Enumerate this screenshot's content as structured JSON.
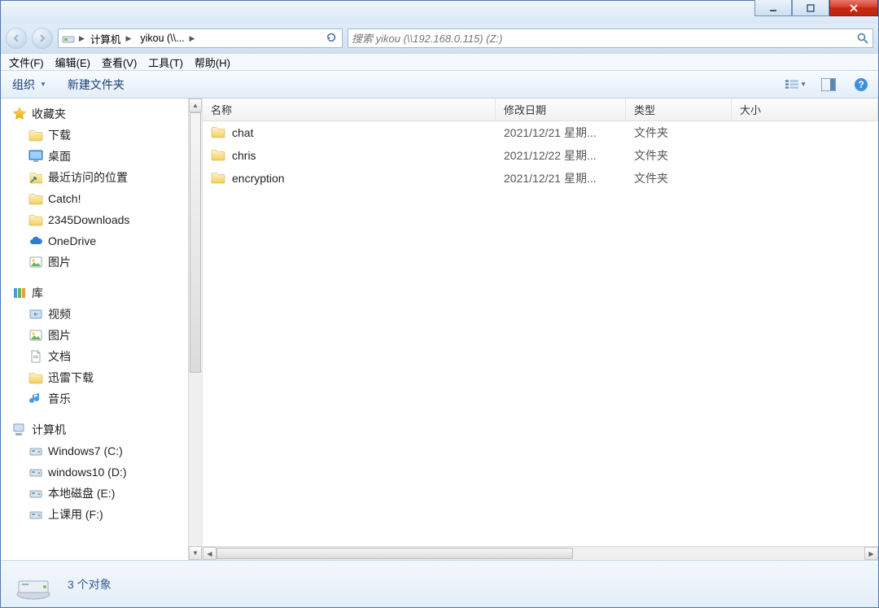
{
  "window": {
    "title": "yikou (\\\\192.168.0.115) (Z:)"
  },
  "breadcrumb": {
    "seg1": "计算机",
    "seg2": "yikou (\\\\...",
    "refresh_tip": "刷新"
  },
  "search": {
    "placeholder": "搜索 yikou (\\\\192.168.0.115) (Z:)"
  },
  "menubar": {
    "file": "文件(F)",
    "edit": "编辑(E)",
    "view": "查看(V)",
    "tools": "工具(T)",
    "help": "帮助(H)"
  },
  "toolbar": {
    "organize": "组织",
    "new_folder": "新建文件夹"
  },
  "sidebar": {
    "favorites": {
      "label": "收藏夹",
      "items": [
        {
          "label": "下载"
        },
        {
          "label": "桌面"
        },
        {
          "label": "最近访问的位置"
        },
        {
          "label": "Catch!"
        },
        {
          "label": "2345Downloads"
        },
        {
          "label": "OneDrive"
        },
        {
          "label": "图片"
        }
      ]
    },
    "libraries": {
      "label": "库",
      "items": [
        {
          "label": "视频"
        },
        {
          "label": "图片"
        },
        {
          "label": "文档"
        },
        {
          "label": "迅雷下载"
        },
        {
          "label": "音乐"
        }
      ]
    },
    "computer": {
      "label": "计算机",
      "items": [
        {
          "label": "Windows7 (C:)"
        },
        {
          "label": "windows10 (D:)"
        },
        {
          "label": "本地磁盘 (E:)"
        },
        {
          "label": "上课用 (F:)"
        }
      ]
    }
  },
  "columns": {
    "name": "名称",
    "date": "修改日期",
    "type": "类型",
    "size": "大小"
  },
  "files": [
    {
      "name": "chat",
      "date": "2021/12/21 星期...",
      "type": "文件夹"
    },
    {
      "name": "chris",
      "date": "2021/12/22 星期...",
      "type": "文件夹"
    },
    {
      "name": "encryption",
      "date": "2021/12/21 星期...",
      "type": "文件夹"
    }
  ],
  "status": {
    "count_text": "3 个对象"
  }
}
